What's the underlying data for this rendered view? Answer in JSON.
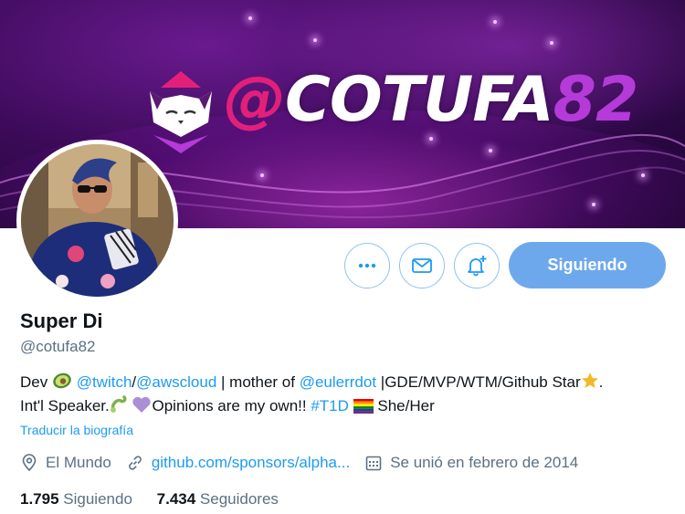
{
  "banner": {
    "logo_at": "@",
    "logo_name": "COTUFA",
    "logo_number": "82"
  },
  "profile": {
    "display_name": "Super Di",
    "handle": "@cotufa82",
    "follow_label": "Siguiendo"
  },
  "bio": {
    "dev": "Dev",
    "twitch": "@twitch",
    "slash": "/",
    "awscloud": "@awscloud",
    "mother_of": " | mother of ",
    "eulerrdot": "@eulerrdot",
    "titles": " |GDE/MVP/WTM/Github Star",
    "dot": ".",
    "speaker": "Int'l Speaker.",
    "opinions": "Opinions are my own!! ",
    "t1d": "#T1D",
    "pronouns": " She/Her"
  },
  "translate_label": "Traducir la biografía",
  "meta": {
    "location": "El Mundo",
    "website": "github.com/sponsors/alpha...",
    "joined": "Se unió en febrero de 2014"
  },
  "stats": {
    "following_count": "1.795",
    "following_label": "Siguiendo",
    "followers_count": "7.434",
    "followers_label": "Seguidores"
  },
  "icons": {
    "more": "more-icon",
    "message": "mail-icon",
    "notifications": "bell-plus-icon",
    "location": "location-pin-icon",
    "website": "link-icon",
    "joined": "calendar-icon"
  },
  "colors": {
    "accent": "#1d9bf0",
    "follow_button": "#6ea8ec",
    "secondary_text": "#5b7083",
    "logo_pink": "#e2207a",
    "logo_purple": "#b43bd8"
  }
}
